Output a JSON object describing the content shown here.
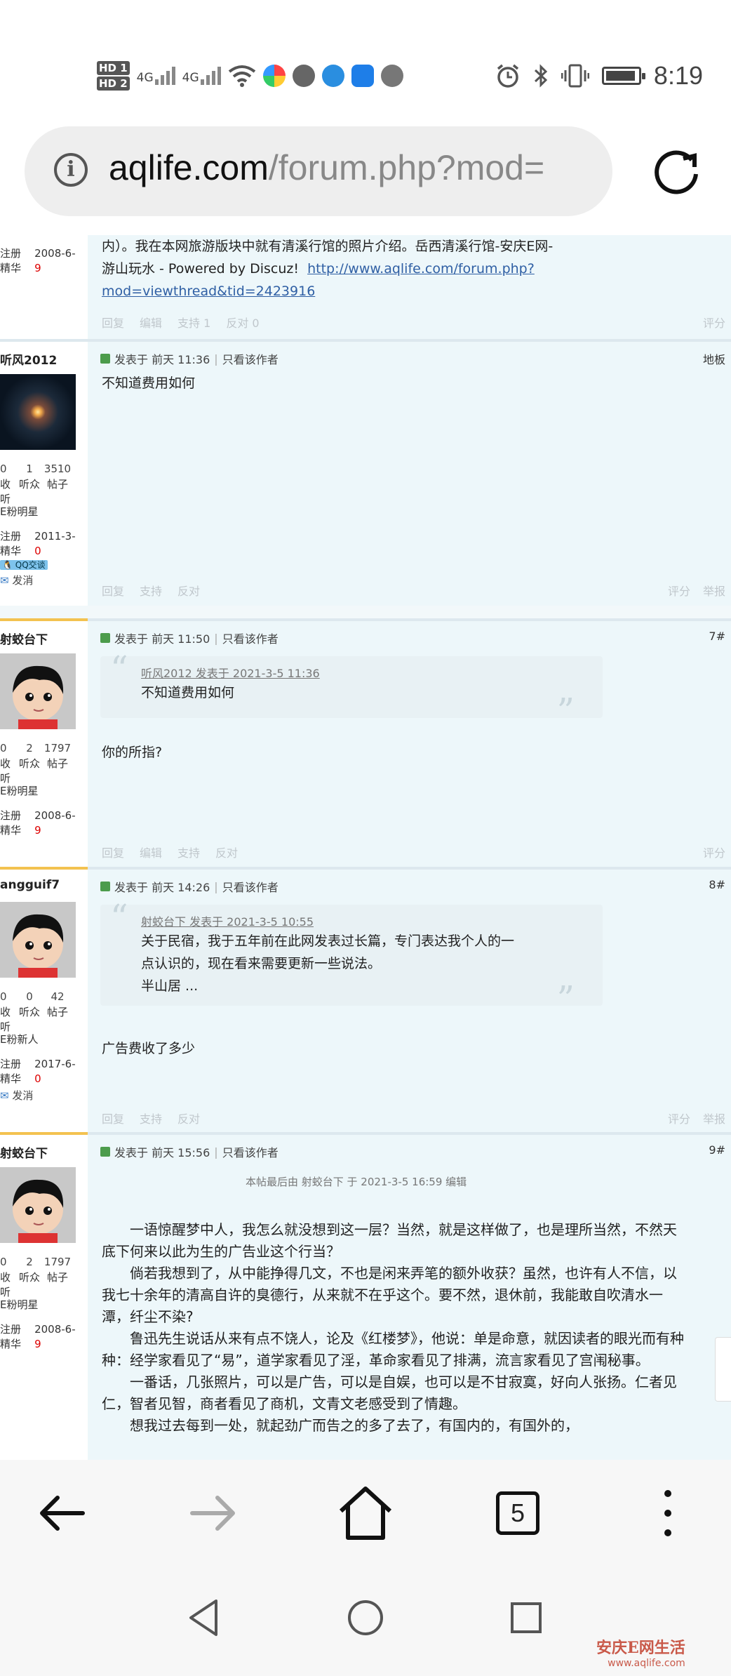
{
  "status_bar": {
    "time": "8:19",
    "hd1": "HD 1",
    "hd2": "HD 2",
    "net1": "4G",
    "net2": "4G"
  },
  "browser": {
    "url_host": "aqlife.com",
    "url_path": "/forum.php?mod=",
    "tab_count": "5"
  },
  "posts": [
    {
      "side_meta1": "注册",
      "side_meta1_val": "2008-6-",
      "side_meta2": "精华",
      "side_meta2_val": "9",
      "text_line1": "内）。我在本网旅游版块中就有清溪行馆的照片介绍。岳西清溪行馆-安庆E网-",
      "text_line2": "游山玩水 - Powered by Discuz!",
      "link1": "http://www.aqlife.com/forum.php?",
      "link2": "mod=viewthread&tid=2423916",
      "actions": [
        "回复",
        "编辑",
        "支持 1",
        "反对 0"
      ],
      "actions_right": [
        "评分"
      ]
    },
    {
      "user": "听风2012",
      "stats_nums": [
        "0",
        "1",
        "3510"
      ],
      "stats_labels": [
        "收听",
        "听众",
        "帖子"
      ],
      "rank": "E粉明星",
      "meta1": "注册",
      "meta1_val": "2011-3-",
      "meta2": "精华",
      "meta2_val": "0",
      "qq": "QQ交谈",
      "msg": "发消",
      "posted": "发表于 前天 11:36",
      "only_author": "只看该作者",
      "floor": "地板",
      "content": "不知道费用如何",
      "actions": [
        "回复",
        "支持",
        "反对"
      ],
      "actions_right": [
        "评分",
        "举报"
      ]
    },
    {
      "user": "射蛟台下",
      "stats_nums": [
        "0",
        "2",
        "1797"
      ],
      "stats_labels": [
        "收听",
        "听众",
        "帖子"
      ],
      "rank": "E粉明星",
      "meta1": "注册",
      "meta1_val": "2008-6-",
      "meta2": "精华",
      "meta2_val": "9",
      "posted": "发表于 前天 11:50",
      "only_author": "只看该作者",
      "floor": "7#",
      "quote_src": "听风2012 发表于 2021-3-5 11:36",
      "quote_text": "不知道费用如何",
      "content": "你的所指?",
      "actions": [
        "回复",
        "编辑",
        "支持",
        "反对"
      ],
      "actions_right": [
        "评分"
      ]
    },
    {
      "user": "angguif7",
      "stats_nums": [
        "0",
        "0",
        "42"
      ],
      "stats_labels": [
        "收听",
        "听众",
        "帖子"
      ],
      "rank": "E粉新人",
      "meta1": "注册",
      "meta1_val": "2017-6-",
      "meta2": "精华",
      "meta2_val": "0",
      "msg": "发消",
      "posted": "发表于 前天 14:26",
      "only_author": "只看该作者",
      "floor": "8#",
      "quote_src": "射蛟台下 发表于 2021-3-5 10:55",
      "quote_line1": "关于民宿，我于五年前在此网发表过长篇，专门表达我个人的一",
      "quote_line2": "点认识的，现在看来需要更新一些说法。",
      "quote_line3": "半山居 ...",
      "content": "广告费收了多少",
      "actions": [
        "回复",
        "支持",
        "反对"
      ],
      "actions_right": [
        "评分",
        "举报"
      ]
    },
    {
      "user": "射蛟台下",
      "stats_nums": [
        "0",
        "2",
        "1797"
      ],
      "stats_labels": [
        "收听",
        "听众",
        "帖子"
      ],
      "rank": "E粉明星",
      "meta1": "注册",
      "meta1_val": "2008-6-",
      "meta2": "精华",
      "meta2_val": "9",
      "posted": "发表于 前天 15:56",
      "only_author": "只看该作者",
      "floor": "9#",
      "edited": "本帖最后由 射蛟台下 于 2021-3-5 16:59 编辑",
      "paragraphs": [
        "一语惊醒梦中人，我怎么就没想到这一层？当然，就是这样做了，也是理所当然，不然天底下何来以此为生的广告业这个行当？",
        "倘若我想到了，从中能挣得几文，不也是闲来弄笔的额外收获？虽然，也许有人不信，以我七十余年的清高自许的臭德行，从来就不在乎这个。要不然，退休前，我能敢自吹清水一潭，纤尘不染?",
        "鲁迅先生说话从来有点不饶人，论及《红楼梦》，他说：单是命意，就因读者的眼光而有种种：经学家看见了“易”，道学家看见了淫，革命家看见了排满，流言家看见了宫闱秘事。",
        "一番话，几张照片，可以是广告，可以是自娱，也可以是不甘寂寞，好向人张扬。仁者见仁，智者见智，商者看见了商机，文青文老感受到了情趣。",
        "想我过去每到一处，就起劲广而告之的多了去了，有国内的，有国外的，"
      ]
    }
  ],
  "watermark": {
    "brand": "安庆E网生活",
    "site": "www.aqlife.com"
  }
}
